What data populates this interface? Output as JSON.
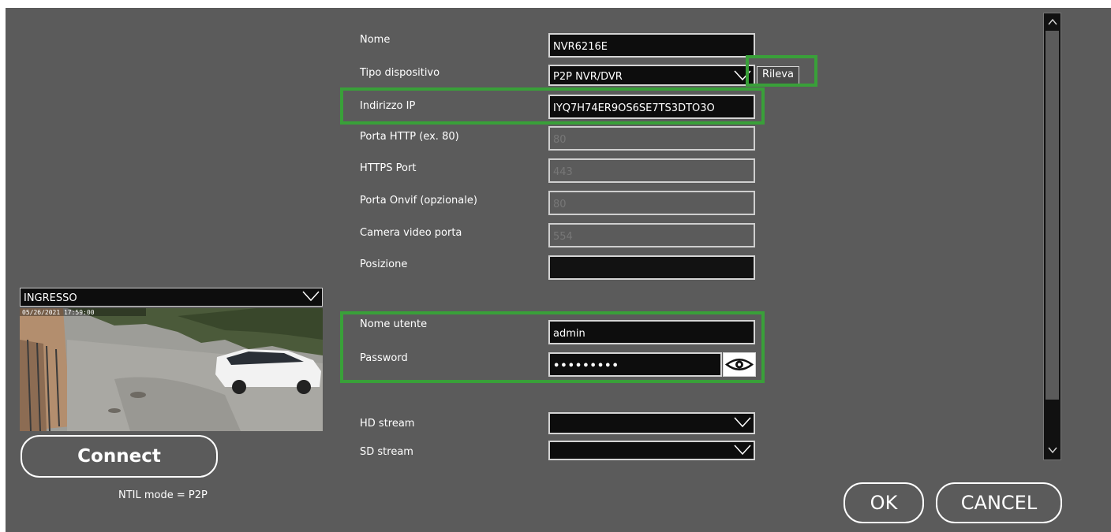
{
  "form": {
    "name": {
      "label": "Nome",
      "value": "NVR6216E"
    },
    "device_type": {
      "label": "Tipo dispositivo",
      "value": "P2P NVR/DVR",
      "detect_label": "Rileva"
    },
    "ip_address": {
      "label": "Indirizzo IP",
      "value": "IYQ7H74ER9OS6SE7TS3DTO3O"
    },
    "http_port": {
      "label": "Porta HTTP (ex. 80)",
      "placeholder": "80"
    },
    "https_port": {
      "label": "HTTPS Port",
      "placeholder": "443"
    },
    "onvif_port": {
      "label": "Porta Onvif (opzionale)",
      "placeholder": "80"
    },
    "video_port": {
      "label": "Camera video porta",
      "placeholder": "554"
    },
    "position": {
      "label": "Posizione",
      "value": ""
    },
    "username": {
      "label": "Nome utente",
      "value": "admin"
    },
    "password": {
      "label": "Password",
      "value": "•••••••••"
    },
    "hd_stream": {
      "label": "HD stream",
      "value": ""
    },
    "sd_stream": {
      "label": "SD stream",
      "value": ""
    }
  },
  "camera": {
    "selected": "INGRESSO",
    "timestamp": "05/26/2021 17:59:00"
  },
  "connect": {
    "label": "Connect",
    "mode_text": "NTIL mode = P2P"
  },
  "dialog": {
    "ok_label": "OK",
    "cancel_label": "CANCEL"
  },
  "icons": {
    "dropdown": "chevron-down-icon",
    "reveal": "eye-icon",
    "scroll_up": "chevron-up-icon",
    "scroll_down": "chevron-down-icon"
  },
  "colors": {
    "panel": "#5b5b5b",
    "highlight": "#39a039",
    "field": "#0d0d0d"
  }
}
